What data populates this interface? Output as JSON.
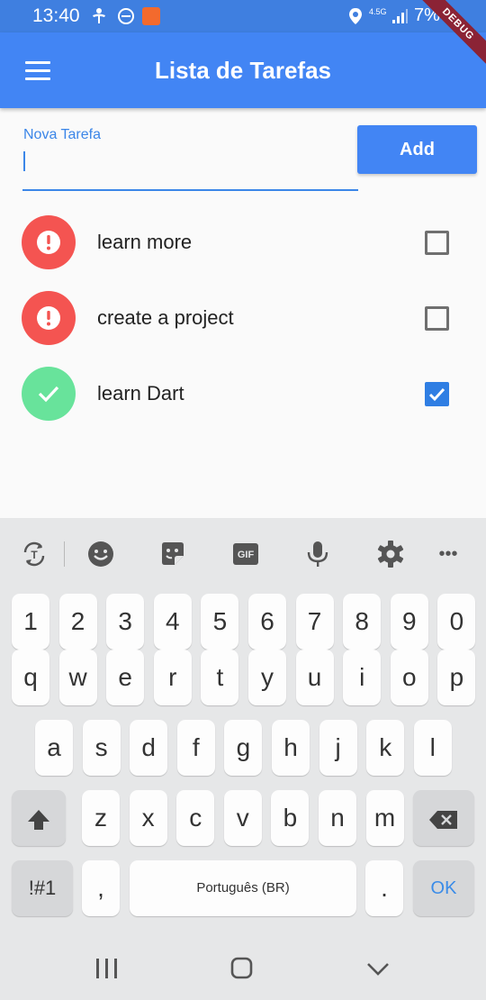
{
  "status_bar": {
    "time": "13:40",
    "battery": "7%",
    "network": "4.5G",
    "icons": [
      "accessibility-icon",
      "do-not-disturb-icon",
      "app-notification-icon",
      "location-icon",
      "network-icon",
      "signal-icon"
    ]
  },
  "debug_banner": "DEBUG",
  "app_bar": {
    "title": "Lista de Tarefas",
    "menu_icon": "hamburger-menu-icon"
  },
  "new_task": {
    "label": "Nova Tarefa",
    "value": "",
    "add_label": "Add"
  },
  "tasks": [
    {
      "title": "learn more",
      "done": false,
      "icon": "error-icon"
    },
    {
      "title": "create a project",
      "done": false,
      "icon": "error-icon"
    },
    {
      "title": "learn Dart",
      "done": true,
      "icon": "check-icon"
    }
  ],
  "colors": {
    "primary": "#4285f4",
    "pending": "#f45451",
    "done": "#68e39b",
    "checkbox_on": "#2f7ee3"
  },
  "keyboard": {
    "toolbar_icons": [
      "translate-icon",
      "emoji-icon",
      "sticker-icon",
      "gif-icon",
      "microphone-icon",
      "settings-icon",
      "more-icon"
    ],
    "gif_label": "GIF",
    "more_label": "•••",
    "row_numbers": [
      "1",
      "2",
      "3",
      "4",
      "5",
      "6",
      "7",
      "8",
      "9",
      "0"
    ],
    "row_1": [
      "q",
      "w",
      "e",
      "r",
      "t",
      "y",
      "u",
      "i",
      "o",
      "p"
    ],
    "row_2": [
      "a",
      "s",
      "d",
      "f",
      "g",
      "h",
      "j",
      "k",
      "l"
    ],
    "row_3": [
      "z",
      "x",
      "c",
      "v",
      "b",
      "n",
      "m"
    ],
    "symbols_key": "!#1",
    "comma_key": ",",
    "space_label": "Português (BR)",
    "period_key": ".",
    "ok_key": "OK"
  },
  "nav_bar": [
    "recent-apps-icon",
    "home-icon",
    "back-icon"
  ]
}
